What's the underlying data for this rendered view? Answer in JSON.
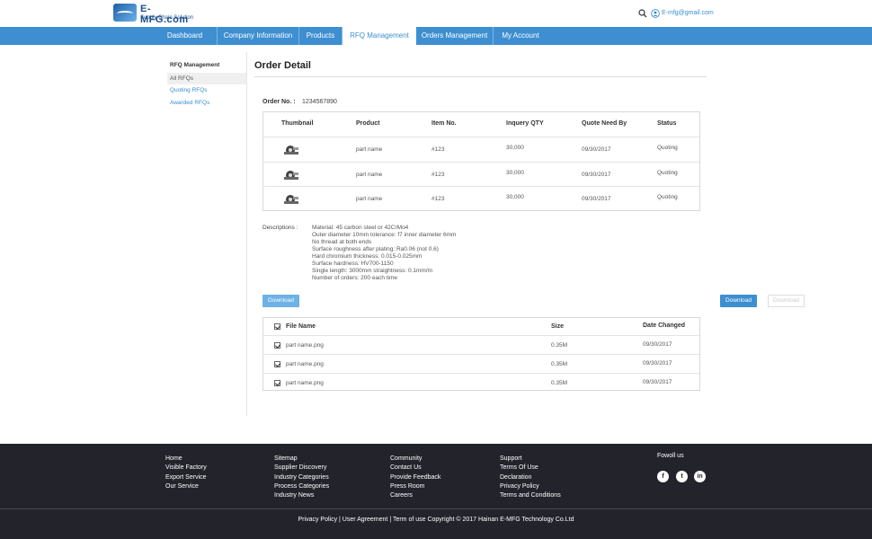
{
  "header": {
    "logo_text": "E-MFG.com",
    "logo_sub": "Supply Chain Solution",
    "email": "E-mfg@gmail.com"
  },
  "nav": {
    "items": [
      {
        "label": "Dashboard"
      },
      {
        "label": "Company Information"
      },
      {
        "label": "Products"
      },
      {
        "label": "RFQ Management",
        "active": true
      },
      {
        "label": "Orders Management"
      },
      {
        "label": "My Account"
      }
    ]
  },
  "sidebar": {
    "title": "RFQ Management",
    "items": [
      {
        "label": "All RFQs",
        "active": true
      },
      {
        "label": "Quoting RFQs"
      },
      {
        "label": "Awarded RFQs"
      }
    ]
  },
  "main": {
    "title": "Order Detail",
    "order_no_label": "Order No. :",
    "order_no": "1234567890",
    "table": {
      "headers": [
        "Thumbnail",
        "Product",
        "Item No.",
        "Inquery QTY",
        "Quote Need By",
        "Status"
      ],
      "rows": [
        {
          "product": "part name",
          "item_no": "#123",
          "qty": "30,000",
          "need_by": "09/30/2017",
          "status": "Quoting"
        },
        {
          "product": "part name",
          "item_no": "#123",
          "qty": "30,000",
          "need_by": "09/30/2017",
          "status": "Quoting"
        },
        {
          "product": "part name",
          "item_no": "#123",
          "qty": "30,000",
          "need_by": "09/30/2017",
          "status": "Quoting"
        }
      ]
    },
    "descriptions_label": "Descriptions :",
    "descriptions": [
      "Material: 45 carbon steel or 42CrMo4",
      "Outer diameter 10mm tolerance: f7 inner diameter 6mm",
      "No thread at both ends",
      "Surface roughness after plating: Ra0.06 (not 0.6)",
      "Hard chromium thickness: 0.015-0.025mm",
      "Surface hardness: HV700-1150",
      "Single length: 3000mm straightness: 0.1mm/m",
      "Number of orders: 200 each time"
    ],
    "download_left": "Download",
    "download_right": "Download",
    "download_disabled": "Download",
    "files": {
      "headers": [
        "File Name",
        "Size",
        "Date Changed"
      ],
      "rows": [
        {
          "name": "part name.png",
          "size": "0.35M",
          "date": "09/30/2017"
        },
        {
          "name": "part name.png",
          "size": "0.35M",
          "date": "09/30/2017"
        },
        {
          "name": "part name.png",
          "size": "0.35M",
          "date": "09/30/2017"
        }
      ]
    }
  },
  "footer": {
    "col1": [
      "Home",
      "Visible Factory",
      "Export Service",
      "Our Service"
    ],
    "col2": [
      "Sitemap",
      "Supplier Discovery",
      "Industry Categories",
      "Process Categories",
      "Industry News"
    ],
    "col3": [
      "Community",
      "Contact Us",
      "Provide Feedback",
      "Press Room",
      "Careers"
    ],
    "col4": [
      "Support",
      "Terms Of Use",
      "Declaration",
      "Privacy Policy",
      "Terms and Conditions"
    ],
    "follow": "Fowoll us",
    "social": [
      "f",
      "t",
      "in"
    ],
    "copyright": "Privacy Policy | User Agreement | Term of use Copyright © 2017 Hainan E-MFG Technology Co.Ltd"
  }
}
